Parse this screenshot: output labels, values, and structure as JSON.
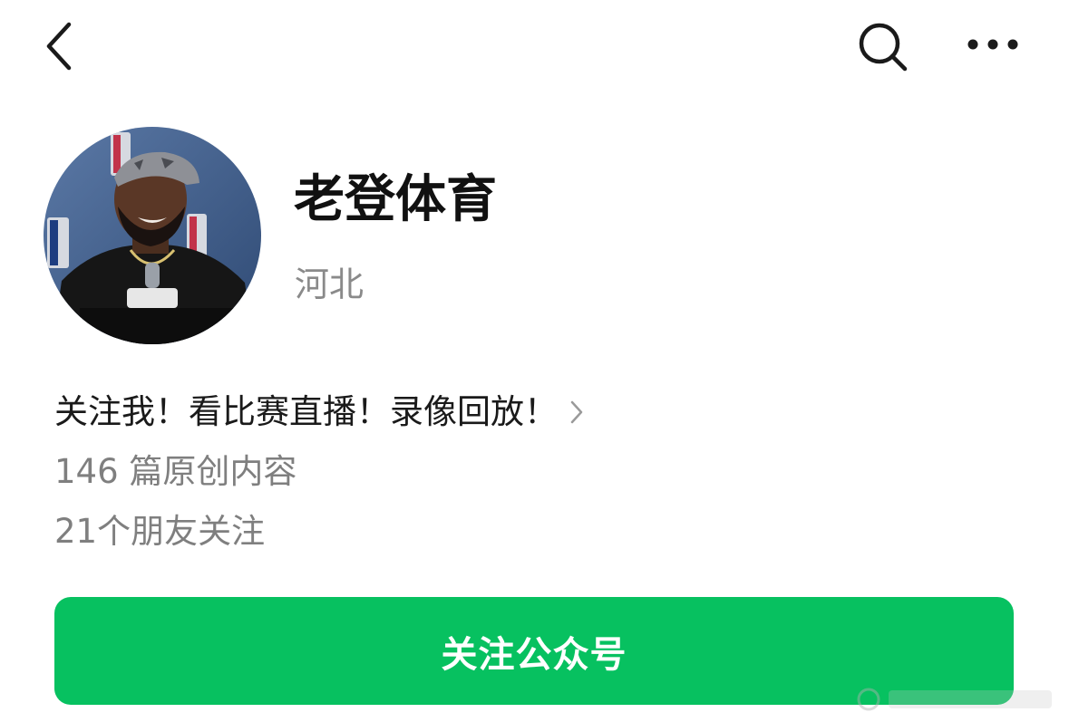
{
  "nav": {
    "back_icon": "chevron-left-icon",
    "search_icon": "search-icon",
    "more_icon": "more-horizontal-icon"
  },
  "profile": {
    "name": "老登体育",
    "location": "河北",
    "avatar": "avatar-photo"
  },
  "intro": {
    "text": "关注我！看比赛直播！录像回放！",
    "chevron_icon": "chevron-right-icon"
  },
  "stats": {
    "articles": "146 篇原创内容",
    "friends": "21个朋友关注"
  },
  "follow_button": {
    "label": "关注公众号",
    "color": "#07c160"
  }
}
